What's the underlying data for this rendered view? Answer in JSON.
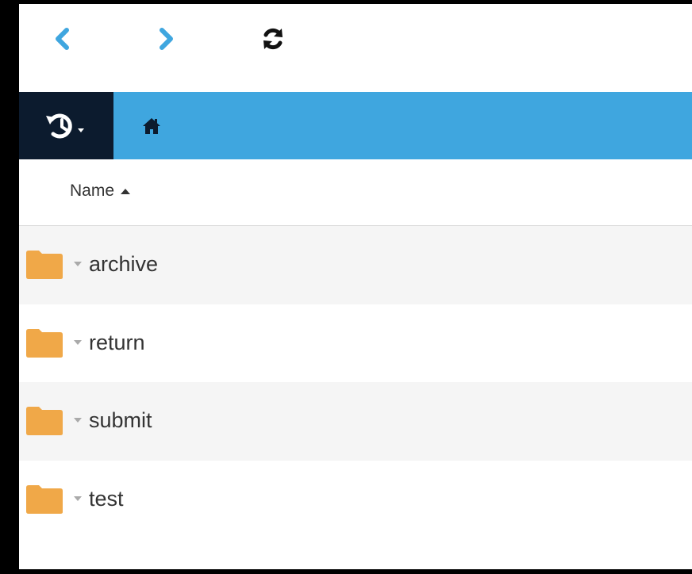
{
  "toolbar": {
    "back_icon": "chevron-left-icon",
    "forward_icon": "chevron-right-icon",
    "refresh_icon": "refresh-icon",
    "accent_color": "#3fa6df"
  },
  "pathbar": {
    "background_color": "#3fa6df",
    "history_background_color": "#0c1b2e",
    "history_icon": "history-icon",
    "home_icon": "home-icon"
  },
  "table": {
    "column_name": "Name",
    "sort_direction": "ascending"
  },
  "files": [
    {
      "name": "archive",
      "type": "folder"
    },
    {
      "name": "return",
      "type": "folder"
    },
    {
      "name": "submit",
      "type": "folder"
    },
    {
      "name": "test",
      "type": "folder"
    }
  ],
  "folder_color": "#f0a848"
}
